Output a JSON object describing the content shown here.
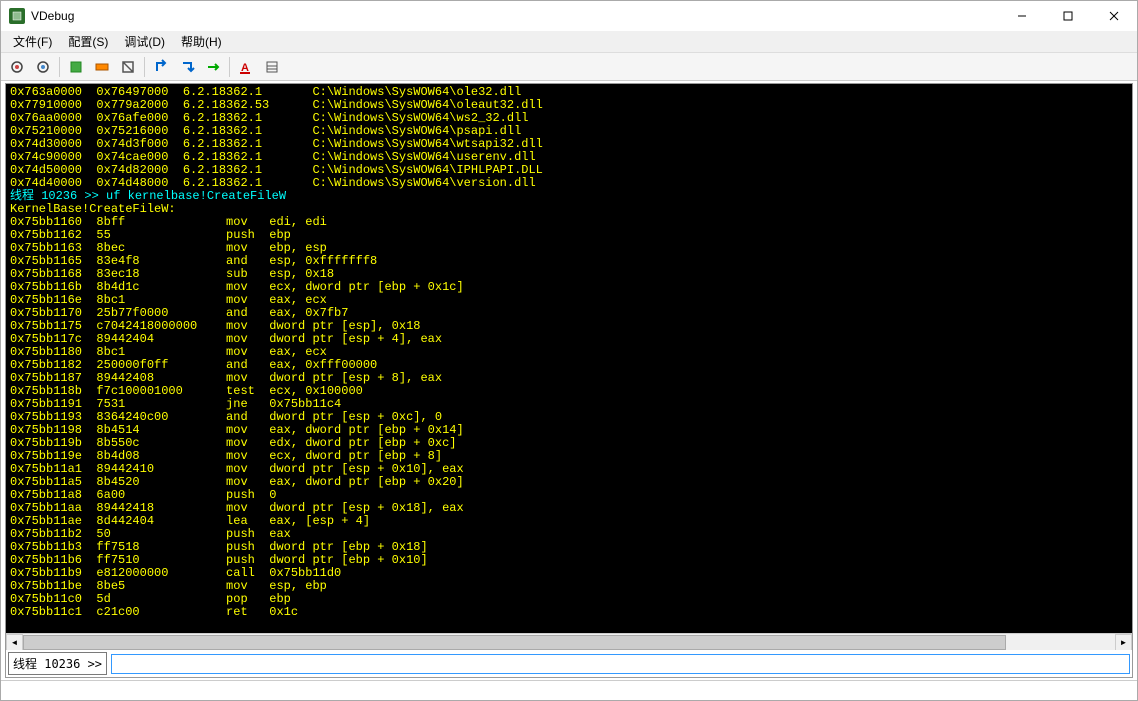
{
  "window": {
    "title": "VDebug"
  },
  "menu": {
    "file": "文件(F)",
    "config": "配置(S)",
    "debug": "调试(D)",
    "help": "帮助(H)"
  },
  "toolbar": {
    "btn1": "tool-1",
    "btn2": "tool-2",
    "btn3": "tool-3",
    "btn4": "tool-4",
    "btn5": "tool-5",
    "btn6": "tool-6",
    "btn7": "tool-7",
    "btn8": "tool-8",
    "btn9": "tool-9",
    "btn10": "tool-10"
  },
  "modules": [
    {
      "base": "0x763a0000",
      "end": "0x76497000",
      "ver": "6.2.18362.1",
      "path": "C:\\Windows\\SysWOW64\\ole32.dll"
    },
    {
      "base": "0x77910000",
      "end": "0x779a2000",
      "ver": "6.2.18362.53",
      "path": "C:\\Windows\\SysWOW64\\oleaut32.dll"
    },
    {
      "base": "0x76aa0000",
      "end": "0x76afe000",
      "ver": "6.2.18362.1",
      "path": "C:\\Windows\\SysWOW64\\ws2_32.dll"
    },
    {
      "base": "0x75210000",
      "end": "0x75216000",
      "ver": "6.2.18362.1",
      "path": "C:\\Windows\\SysWOW64\\psapi.dll"
    },
    {
      "base": "0x74d30000",
      "end": "0x74d3f000",
      "ver": "6.2.18362.1",
      "path": "C:\\Windows\\SysWOW64\\wtsapi32.dll"
    },
    {
      "base": "0x74c90000",
      "end": "0x74cae000",
      "ver": "6.2.18362.1",
      "path": "C:\\Windows\\SysWOW64\\userenv.dll"
    },
    {
      "base": "0x74d50000",
      "end": "0x74d82000",
      "ver": "6.2.18362.1",
      "path": "C:\\Windows\\SysWOW64\\IPHLPAPI.DLL"
    },
    {
      "base": "0x74d40000",
      "end": "0x74d48000",
      "ver": "6.2.18362.1",
      "path": "C:\\Windows\\SysWOW64\\version.dll"
    }
  ],
  "cmd_header": {
    "thread_label": "线程",
    "thread_id": "10236",
    "sep": ">>",
    "cmd": "uf kernelbase!CreateFileW"
  },
  "func_header": "KernelBase!CreateFileW:",
  "disasm": [
    {
      "addr": "0x75bb1160",
      "bytes": "8bff",
      "mn": "mov",
      "ops": "edi, edi"
    },
    {
      "addr": "0x75bb1162",
      "bytes": "55",
      "mn": "push",
      "ops": "ebp"
    },
    {
      "addr": "0x75bb1163",
      "bytes": "8bec",
      "mn": "mov",
      "ops": "ebp, esp"
    },
    {
      "addr": "0x75bb1165",
      "bytes": "83e4f8",
      "mn": "and",
      "ops": "esp, 0xfffffff8"
    },
    {
      "addr": "0x75bb1168",
      "bytes": "83ec18",
      "mn": "sub",
      "ops": "esp, 0x18"
    },
    {
      "addr": "0x75bb116b",
      "bytes": "8b4d1c",
      "mn": "mov",
      "ops": "ecx, dword ptr [ebp + 0x1c]"
    },
    {
      "addr": "0x75bb116e",
      "bytes": "8bc1",
      "mn": "mov",
      "ops": "eax, ecx"
    },
    {
      "addr": "0x75bb1170",
      "bytes": "25b77f0000",
      "mn": "and",
      "ops": "eax, 0x7fb7"
    },
    {
      "addr": "0x75bb1175",
      "bytes": "c7042418000000",
      "mn": "mov",
      "ops": "dword ptr [esp], 0x18"
    },
    {
      "addr": "0x75bb117c",
      "bytes": "89442404",
      "mn": "mov",
      "ops": "dword ptr [esp + 4], eax"
    },
    {
      "addr": "0x75bb1180",
      "bytes": "8bc1",
      "mn": "mov",
      "ops": "eax, ecx"
    },
    {
      "addr": "0x75bb1182",
      "bytes": "250000f0ff",
      "mn": "and",
      "ops": "eax, 0xfff00000"
    },
    {
      "addr": "0x75bb1187",
      "bytes": "89442408",
      "mn": "mov",
      "ops": "dword ptr [esp + 8], eax"
    },
    {
      "addr": "0x75bb118b",
      "bytes": "f7c100001000",
      "mn": "test",
      "ops": "ecx, 0x100000"
    },
    {
      "addr": "0x75bb1191",
      "bytes": "7531",
      "mn": "jne",
      "ops": "0x75bb11c4"
    },
    {
      "addr": "0x75bb1193",
      "bytes": "8364240c00",
      "mn": "and",
      "ops": "dword ptr [esp + 0xc], 0"
    },
    {
      "addr": "0x75bb1198",
      "bytes": "8b4514",
      "mn": "mov",
      "ops": "eax, dword ptr [ebp + 0x14]"
    },
    {
      "addr": "0x75bb119b",
      "bytes": "8b550c",
      "mn": "mov",
      "ops": "edx, dword ptr [ebp + 0xc]"
    },
    {
      "addr": "0x75bb119e",
      "bytes": "8b4d08",
      "mn": "mov",
      "ops": "ecx, dword ptr [ebp + 8]"
    },
    {
      "addr": "0x75bb11a1",
      "bytes": "89442410",
      "mn": "mov",
      "ops": "dword ptr [esp + 0x10], eax"
    },
    {
      "addr": "0x75bb11a5",
      "bytes": "8b4520",
      "mn": "mov",
      "ops": "eax, dword ptr [ebp + 0x20]"
    },
    {
      "addr": "0x75bb11a8",
      "bytes": "6a00",
      "mn": "push",
      "ops": "0"
    },
    {
      "addr": "0x75bb11aa",
      "bytes": "89442418",
      "mn": "mov",
      "ops": "dword ptr [esp + 0x18], eax"
    },
    {
      "addr": "0x75bb11ae",
      "bytes": "8d442404",
      "mn": "lea",
      "ops": "eax, [esp + 4]"
    },
    {
      "addr": "0x75bb11b2",
      "bytes": "50",
      "mn": "push",
      "ops": "eax"
    },
    {
      "addr": "0x75bb11b3",
      "bytes": "ff7518",
      "mn": "push",
      "ops": "dword ptr [ebp + 0x18]"
    },
    {
      "addr": "0x75bb11b6",
      "bytes": "ff7510",
      "mn": "push",
      "ops": "dword ptr [ebp + 0x10]"
    },
    {
      "addr": "0x75bb11b9",
      "bytes": "e812000000",
      "mn": "call",
      "ops": "0x75bb11d0"
    },
    {
      "addr": "0x75bb11be",
      "bytes": "8be5",
      "mn": "mov",
      "ops": "esp, ebp"
    },
    {
      "addr": "0x75bb11c0",
      "bytes": "5d",
      "mn": "pop",
      "ops": "ebp"
    },
    {
      "addr": "0x75bb11c1",
      "bytes": "c21c00",
      "mn": "ret",
      "ops": "0x1c"
    }
  ],
  "prompt": {
    "text": "线程 10236 >>"
  },
  "input": {
    "value": ""
  },
  "colors": {
    "bg": "#000000",
    "text": "#ffff00",
    "accent": "#00ffff"
  }
}
